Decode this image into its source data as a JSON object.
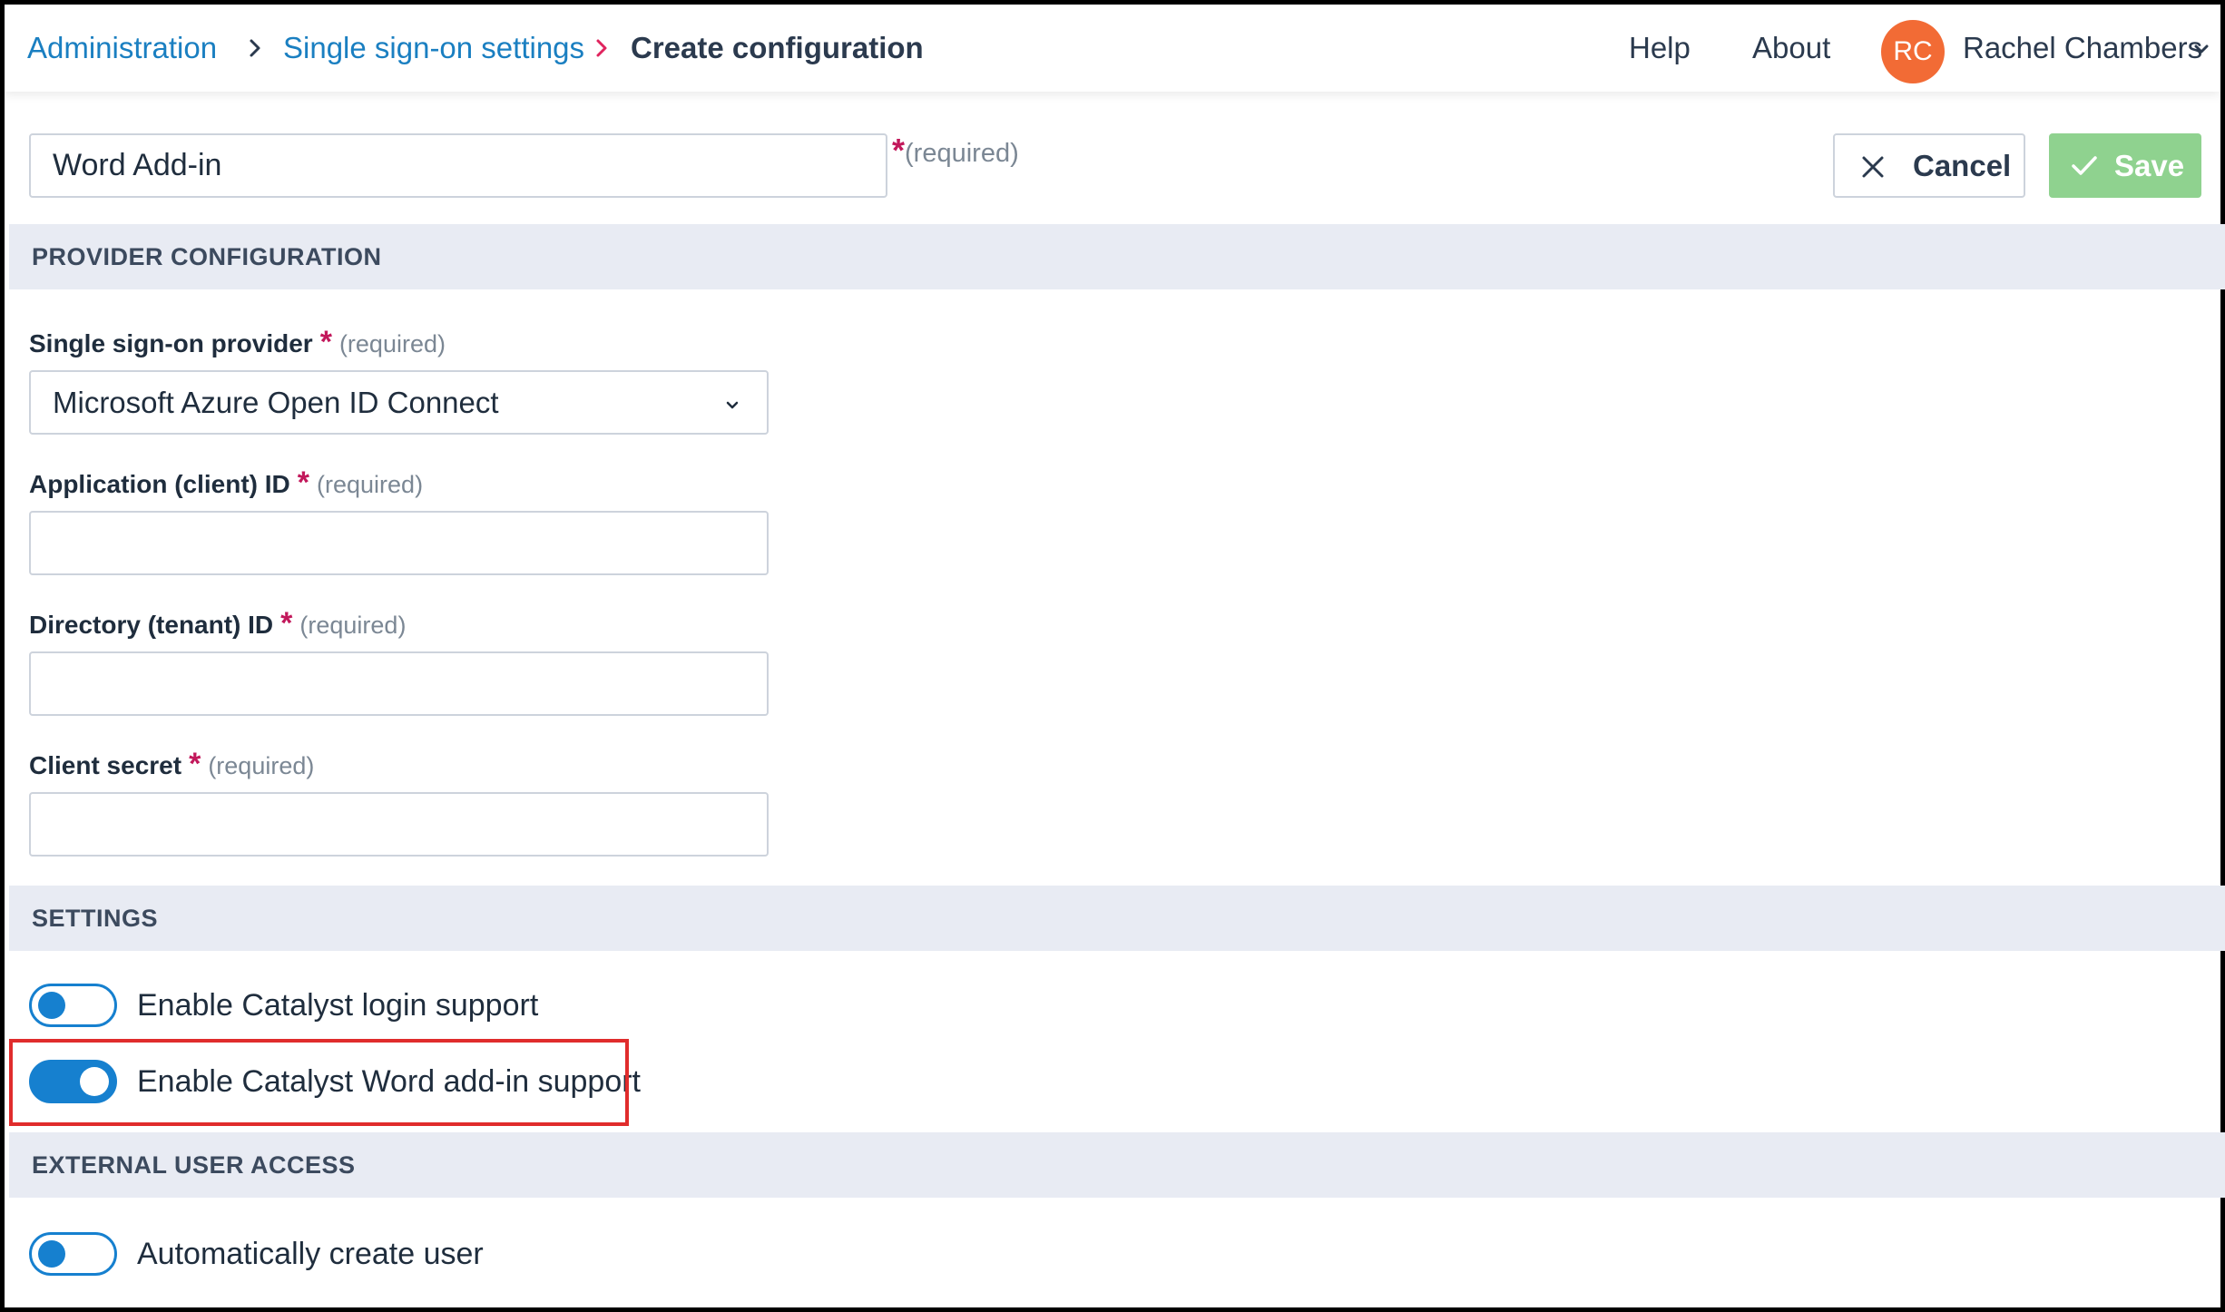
{
  "breadcrumb": {
    "items": [
      "Administration",
      "Single sign-on settings"
    ],
    "current": "Create configuration"
  },
  "nav": {
    "help": "Help",
    "about": "About",
    "user_initials": "RC",
    "user_name": "Rachel Chambers"
  },
  "config_name": {
    "value": "Word Add-in",
    "required_star": "*",
    "required_text": "(required)"
  },
  "actions": {
    "cancel": "Cancel",
    "save": "Save"
  },
  "sections": {
    "provider": "PROVIDER CONFIGURATION",
    "settings": "SETTINGS",
    "external": "EXTERNAL USER ACCESS"
  },
  "fields": {
    "required_star": "*",
    "required_text": "(required)",
    "provider_label": "Single sign-on provider",
    "provider_value": "Microsoft Azure Open ID Connect",
    "app_id_label": "Application (client) ID",
    "app_id_value": "",
    "tenant_label": "Directory (tenant) ID",
    "tenant_value": "",
    "secret_label": "Client secret",
    "secret_value": ""
  },
  "settings": {
    "login_label": "Enable Catalyst login support",
    "login_enabled": false,
    "word_label": "Enable Catalyst Word add-in support",
    "word_enabled": true
  },
  "external": {
    "auto_create_label": "Automatically create user",
    "auto_create_enabled": false
  },
  "colors": {
    "link": "#1a7fc1",
    "breadcrumb_separator_current": "#e0245e",
    "required_star": "#c2185b",
    "avatar": "#f26b35",
    "save_button": "#8fd28f",
    "toggle": "#1680cf",
    "section_bar": "#e8ebf3",
    "highlight": "#e02c2c"
  }
}
